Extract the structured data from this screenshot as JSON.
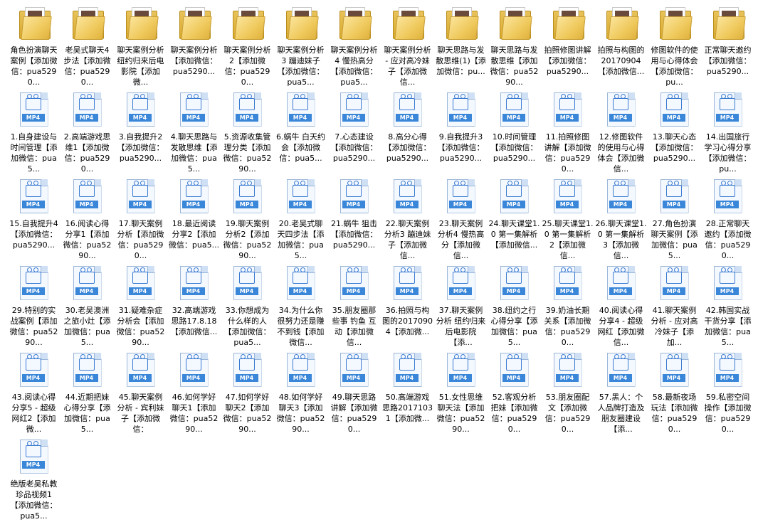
{
  "folders": [
    {
      "label": "角色扮演聊天案例【添加微信：pua5290..."
    },
    {
      "label": "老吴式聊天4步法【添加微信：pua5290..."
    },
    {
      "label": "聊天案例分析 纽约归来后电影院【添加微..."
    },
    {
      "label": "聊天案例分析【添加微信：pua5290..."
    },
    {
      "label": "聊天案例分析2【添加微信：pua5290..."
    },
    {
      "label": "聊天案例分析3 蹦迪妹子【添加微信：pua5..."
    },
    {
      "label": "聊天案例分析4 慢热高分【添加微信：pua5..."
    },
    {
      "label": "聊天案例分析 - 应对高冷妹子【添加微信..."
    },
    {
      "label": "聊天思路与发散思维(1)【添加微信：pu..."
    },
    {
      "label": "聊天思路与发散思维【添加微信：pua5290..."
    },
    {
      "label": "拍照修图讲解【添加微信：pua5290..."
    },
    {
      "label": "拍照与构图的20170904【添加微信..."
    },
    {
      "label": "修图软件的使用与心得体会【添加微信：pu..."
    },
    {
      "label": "正常聊天邀约【添加微信：pua5290..."
    }
  ],
  "files": [
    {
      "label": "1.自身建设与时间管理【添加微信：pua5..."
    },
    {
      "label": "2.高端游戏思维1【添加微信：pua5290..."
    },
    {
      "label": "3.自我提升2【添加微信：pua5290..."
    },
    {
      "label": "4.聊天思路与发散思维【添加微信：pua5..."
    },
    {
      "label": "5.资源收集管理分类【添加微信：pua5290..."
    },
    {
      "label": "6.蜗牛 白天约会【添加微信：pua5..."
    },
    {
      "label": "7.心态建设【添加微信：pua5290..."
    },
    {
      "label": "8.高分心得【添加微信：pua5290..."
    },
    {
      "label": "9.自我提升3【添加微信：pua5290..."
    },
    {
      "label": "10.时间管理【添加微信：pua5290..."
    },
    {
      "label": "11.拍照修图讲解【添加微信：pua5290..."
    },
    {
      "label": "12.修图软件的使用与心得体会【添加微信..."
    },
    {
      "label": "13.聊天心态【添加微信：pua5290..."
    },
    {
      "label": "14.出国旅行学习心得分享【添加微信：pu..."
    },
    {
      "label": "15.自我提升4【添加微信：pua5290..."
    },
    {
      "label": "16.阅读心得分享1【添加微信：pua5290..."
    },
    {
      "label": "17.聊天案例分析【添加微信：pua5290..."
    },
    {
      "label": "18.最近阅读分享2【添加微信：pua5..."
    },
    {
      "label": "19.聊天案例分析2【添加微信：pua5290..."
    },
    {
      "label": "20.老吴式聊天四步法【添加微信：pua5..."
    },
    {
      "label": "21.蜗牛 狙击【添加微信：pua5290..."
    },
    {
      "label": "22.聊天案例分析3 蹦迪妹子【添加微信..."
    },
    {
      "label": "23.聊天案例分析4 慢热高分【添加微信..."
    },
    {
      "label": "24.聊天课堂1.0 第一集解析【添加微信..."
    },
    {
      "label": "25.聊天课堂1.0 第一集解析2【添加微信..."
    },
    {
      "label": "26.聊天课堂1.0 第一集解析3【添加微信..."
    },
    {
      "label": "27.角色扮演聊天案例【添加微信：pua5..."
    },
    {
      "label": "28.正常聊天邀约【添加微信：pua5290..."
    },
    {
      "label": "29.特别的实战案例【添加微信：pua5290..."
    },
    {
      "label": "30.老吴澳洲之旅小灶【添加微信：pua5..."
    },
    {
      "label": "31.疑难杂症分析会【添加微信：pua5290..."
    },
    {
      "label": "32.高端游戏思路17.8.18【添加微信..."
    },
    {
      "label": "33.你想成为什么样的人【添加微信：pua5..."
    },
    {
      "label": "34.为什么你很努力还是赚不到钱【添加微信..."
    },
    {
      "label": "35.朋友圈那些事 钓鱼 互动【添加微信..."
    },
    {
      "label": "36.拍照与构图的20170904【添加微..."
    },
    {
      "label": "37.聊天案例分析 纽约归来后电影院【添..."
    },
    {
      "label": "38.纽约之行心得分享【添加微信：pua5..."
    },
    {
      "label": "39.奶油长期关系【添加微信：pua5290..."
    },
    {
      "label": "40.阅读心得分享4 - 超级网红【添加微信..."
    },
    {
      "label": "41.聊天案例分析 - 应对高冷妹子【添加..."
    },
    {
      "label": "42.韩国实战干货分享【添加微信：pua5..."
    },
    {
      "label": "43.阅读心得分享5 - 超级网红2【添加微..."
    },
    {
      "label": "44.近期把妹心得分享【添加微信：pua5..."
    },
    {
      "label": "45.聊天案例分析 - 宾利妹子【添加微信："
    },
    {
      "label": "46.如何学好聊天1【添加微信：pua5290..."
    },
    {
      "label": "47.如何学好聊天2【添加微信：pua5290..."
    },
    {
      "label": "48.如何学好聊天3【添加微信：pua5290..."
    },
    {
      "label": "49.聊天思路讲解【添加微信：pua5290..."
    },
    {
      "label": "50.高端游戏思路20171031【添加微..."
    },
    {
      "label": "51.女性思维聊天法【添加微信：pua5290..."
    },
    {
      "label": "52.客观分析把妹【添加微信：pua5290..."
    },
    {
      "label": "53.朋友圈配文【添加微信：pua5290..."
    },
    {
      "label": "57.黑人：个人品牌打造及朋友圈建设【添..."
    },
    {
      "label": "58.最新夜场玩法【添加微信：pua5290..."
    },
    {
      "label": "59.私密空间操作【添加微信：pua5290..."
    },
    {
      "label": "绝版老吴私教珍品视频1【添加微信：pua5..."
    }
  ],
  "badge": "MP4",
  "icons": {
    "folder": "folder-icon",
    "video": "mp4-video-icon"
  },
  "colors": {
    "folder": "#e8c35a",
    "badge": "#3a86d8",
    "camera": "#3b7bd0"
  }
}
